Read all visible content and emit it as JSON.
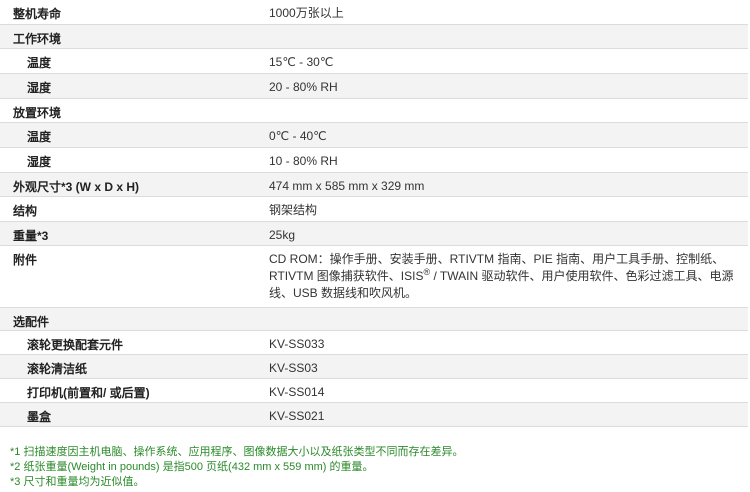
{
  "rows": [
    {
      "label": "整机寿命",
      "value": "1000万张以上"
    },
    {
      "label": "工作环境",
      "value": ""
    },
    {
      "label": "温度",
      "value": "15℃ - 30℃"
    },
    {
      "label": "湿度",
      "value": "20 - 80% RH"
    },
    {
      "label": "放置环境",
      "value": ""
    },
    {
      "label": "温度",
      "value": "0℃ - 40℃"
    },
    {
      "label": "湿度",
      "value": "10 - 80% RH"
    },
    {
      "label": "外观尺寸*3 (W x D x H)",
      "value": "474 mm x 585 mm x 329 mm"
    },
    {
      "label": "结构",
      "value": "钢架结构"
    },
    {
      "label": "重量*3",
      "value": "25kg"
    },
    {
      "label": "附件",
      "value_a": "CD ROM：操作手册、安装手册、RTIVTM 指南、PIE 指南、用户工具手册、控制纸、",
      "value_b": "RTIVTM 图像捕获软件、ISIS",
      "value_sup": "®",
      "value_c": " / TWAIN 驱动软件、用户使用软件、色彩过滤工具、电源",
      "value_d": "线、USB 数据线和吹风机。"
    },
    {
      "label": "选配件",
      "value": ""
    },
    {
      "label": "滚轮更换配套元件",
      "value": "KV-SS033"
    },
    {
      "label": "滚轮清洁纸",
      "value": "KV-SS03"
    },
    {
      "label": "打印机(前置和/ 或后置)",
      "value": "KV-SS014"
    },
    {
      "label": "墨盒",
      "value": "KV-SS021"
    }
  ],
  "notes": [
    "*1 扫描速度因主机电脑、操作系统、应用程序、图像数据大小以及纸张类型不同而存在差异。",
    "*2 纸张重量(Weight in pounds) 是指500 页纸(432 mm x 559 mm) 的重量。",
    "*3 尺寸和重量均为近似值。"
  ]
}
